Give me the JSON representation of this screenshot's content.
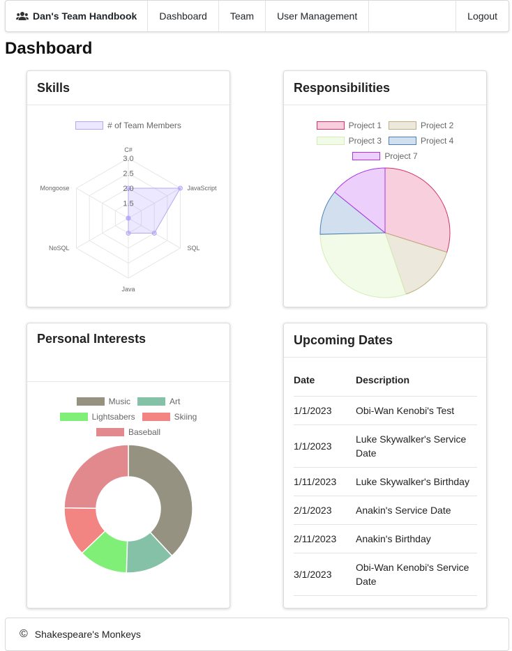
{
  "navbar": {
    "brand": "Dan's Team Handbook",
    "links": [
      "Dashboard",
      "Team",
      "User Management"
    ],
    "logout": "Logout"
  },
  "page_title": "Dashboard",
  "cards": {
    "skills": {
      "title": "Skills"
    },
    "responsibilities": {
      "title": "Responsibilities"
    },
    "interests": {
      "title": "Personal Interests"
    },
    "dates": {
      "title": "Upcoming Dates"
    }
  },
  "upcoming_dates": {
    "headers": [
      "Date",
      "Description"
    ],
    "rows": [
      {
        "date": "1/1/2023",
        "description": "Obi-Wan Kenobi's Test"
      },
      {
        "date": "1/1/2023",
        "description": "Luke Skywalker's Service Date"
      },
      {
        "date": "1/11/2023",
        "description": "Luke Skywalker's Birthday"
      },
      {
        "date": "2/1/2023",
        "description": "Anakin's Service Date"
      },
      {
        "date": "2/11/2023",
        "description": "Anakin's Birthday"
      },
      {
        "date": "3/1/2023",
        "description": "Obi-Wan Kenobi's Service Date"
      }
    ]
  },
  "footer": {
    "icon": "copyright-icon",
    "text": "Shakespeare's Monkeys"
  },
  "chart_data": [
    {
      "type": "radar",
      "legend": [
        "# of Team Members"
      ],
      "categories": [
        "C#",
        "JavaScript",
        "SQL",
        "Java",
        "NoSQL",
        "Mongoose"
      ],
      "series": [
        {
          "name": "# of Team Members",
          "values": [
            2,
            3,
            2,
            1.5,
            1,
            1
          ]
        }
      ],
      "ticks": [
        "1.5",
        "2.0",
        "2.5",
        "3.0"
      ],
      "rlim": [
        1,
        3
      ],
      "colors": {
        "fill": "rgba(153,140,255,0.2)",
        "stroke": "#b3a9f2"
      }
    },
    {
      "type": "pie",
      "legend": [
        "Project 1",
        "Project 2",
        "Project 3",
        "Project 4",
        "Project 7"
      ],
      "values": [
        4,
        2,
        4,
        1.5,
        1.9
      ],
      "colors": {
        "fill": [
          "#f8cfdd",
          "#ece8dc",
          "#f2fbe8",
          "#d2dfee",
          "#ecd0fb"
        ],
        "stroke": [
          "#d1336a",
          "#bfae80",
          "#d6ecb6",
          "#4a7fb4",
          "#aa33e6"
        ]
      }
    },
    {
      "type": "doughnut",
      "legend": [
        "Music",
        "Art",
        "Lightsabers",
        "Skiing",
        "Baseball"
      ],
      "values": [
        4,
        1.3,
        1.3,
        1.3,
        2.6
      ],
      "colors": {
        "fill": [
          "#969281",
          "#84c1a7",
          "#80ef78",
          "#f28482",
          "#e1898c"
        ]
      }
    }
  ]
}
